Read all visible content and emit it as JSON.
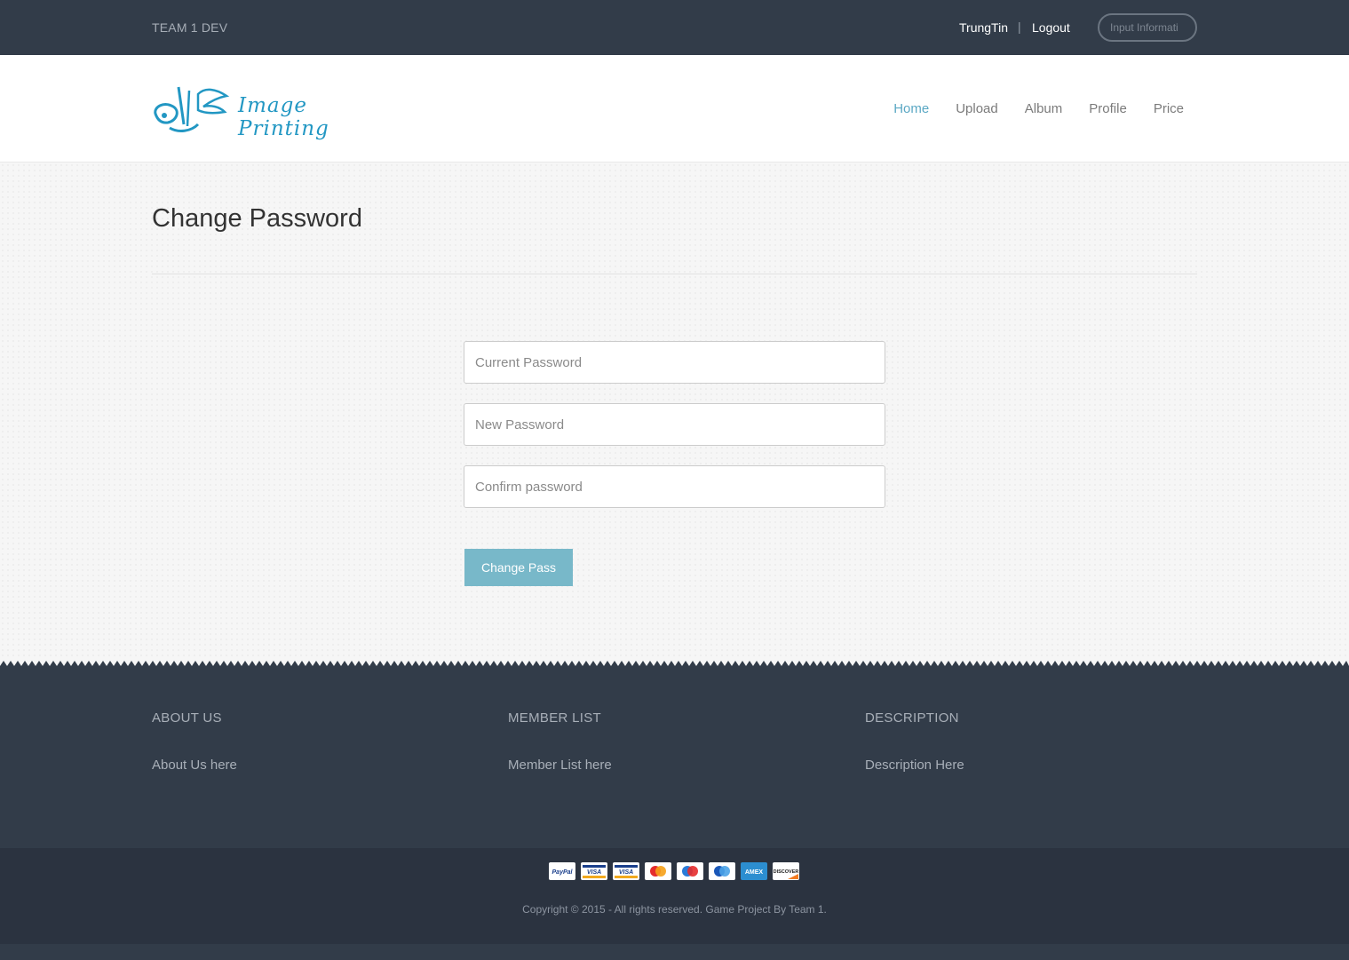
{
  "topbar": {
    "brand": "TEAM 1 DEV",
    "username": "TrungTin",
    "separator": "|",
    "logout": "Logout",
    "input_placeholder": "Input Informati"
  },
  "header": {
    "logo_text": "Image Printing",
    "nav": [
      {
        "label": "Home",
        "active": true
      },
      {
        "label": "Upload",
        "active": false
      },
      {
        "label": "Album",
        "active": false
      },
      {
        "label": "Profile",
        "active": false
      },
      {
        "label": "Price",
        "active": false
      }
    ]
  },
  "main": {
    "title": "Change Password",
    "fields": {
      "current_placeholder": "Current Password",
      "new_placeholder": "New Password",
      "confirm_placeholder": "Confirm password"
    },
    "submit_label": "Change Pass"
  },
  "footer": {
    "columns": [
      {
        "heading": "ABOUT US",
        "text": "About Us here"
      },
      {
        "heading": "MEMBER LIST",
        "text": "Member List here"
      },
      {
        "heading": "DESCRIPTION",
        "text": "Description Here"
      }
    ],
    "payment_icons": [
      "paypal-icon",
      "visa-icon",
      "visa-electron-icon",
      "mastercard-icon",
      "maestro-icon",
      "maestro-blue-icon",
      "amex-icon",
      "discover-icon"
    ],
    "copyright": "Copyright © 2015 - All rights reserved. Game Project By Team 1."
  },
  "colors": {
    "dark": "#323c49",
    "accent": "#5ba8c4",
    "button": "#78b8c9"
  }
}
